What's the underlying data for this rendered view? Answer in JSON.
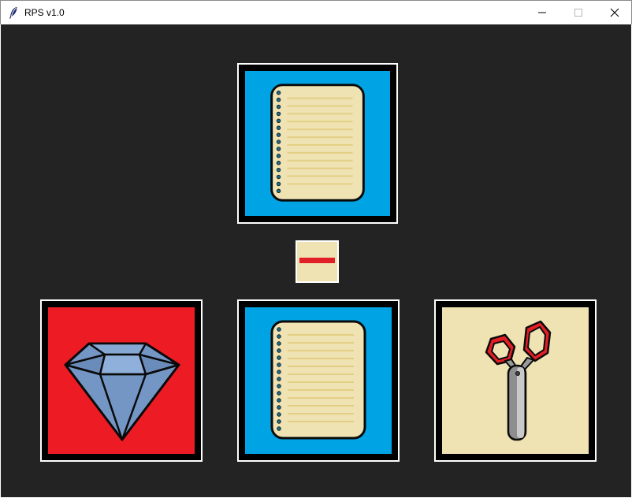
{
  "window": {
    "title": "RPS v1.0",
    "controls": [
      "minimize",
      "maximize",
      "close"
    ]
  },
  "colors": {
    "background": "#232323",
    "paper_bg": "#00a4e4",
    "rock_bg": "#ed1c24",
    "scissors_bg": "#efe2b3",
    "card_border": "#ffffff",
    "card_frame": "#000000",
    "result_bar": "#e11f26"
  },
  "computer_choice": {
    "icon": "notebook-paper-icon",
    "choice": "paper"
  },
  "result": {
    "icon": "minus-icon",
    "outcome": "draw"
  },
  "player_options": [
    {
      "choice": "rock",
      "icon": "diamond-icon"
    },
    {
      "choice": "paper",
      "icon": "notebook-paper-icon"
    },
    {
      "choice": "scissors",
      "icon": "scissors-icon"
    }
  ]
}
